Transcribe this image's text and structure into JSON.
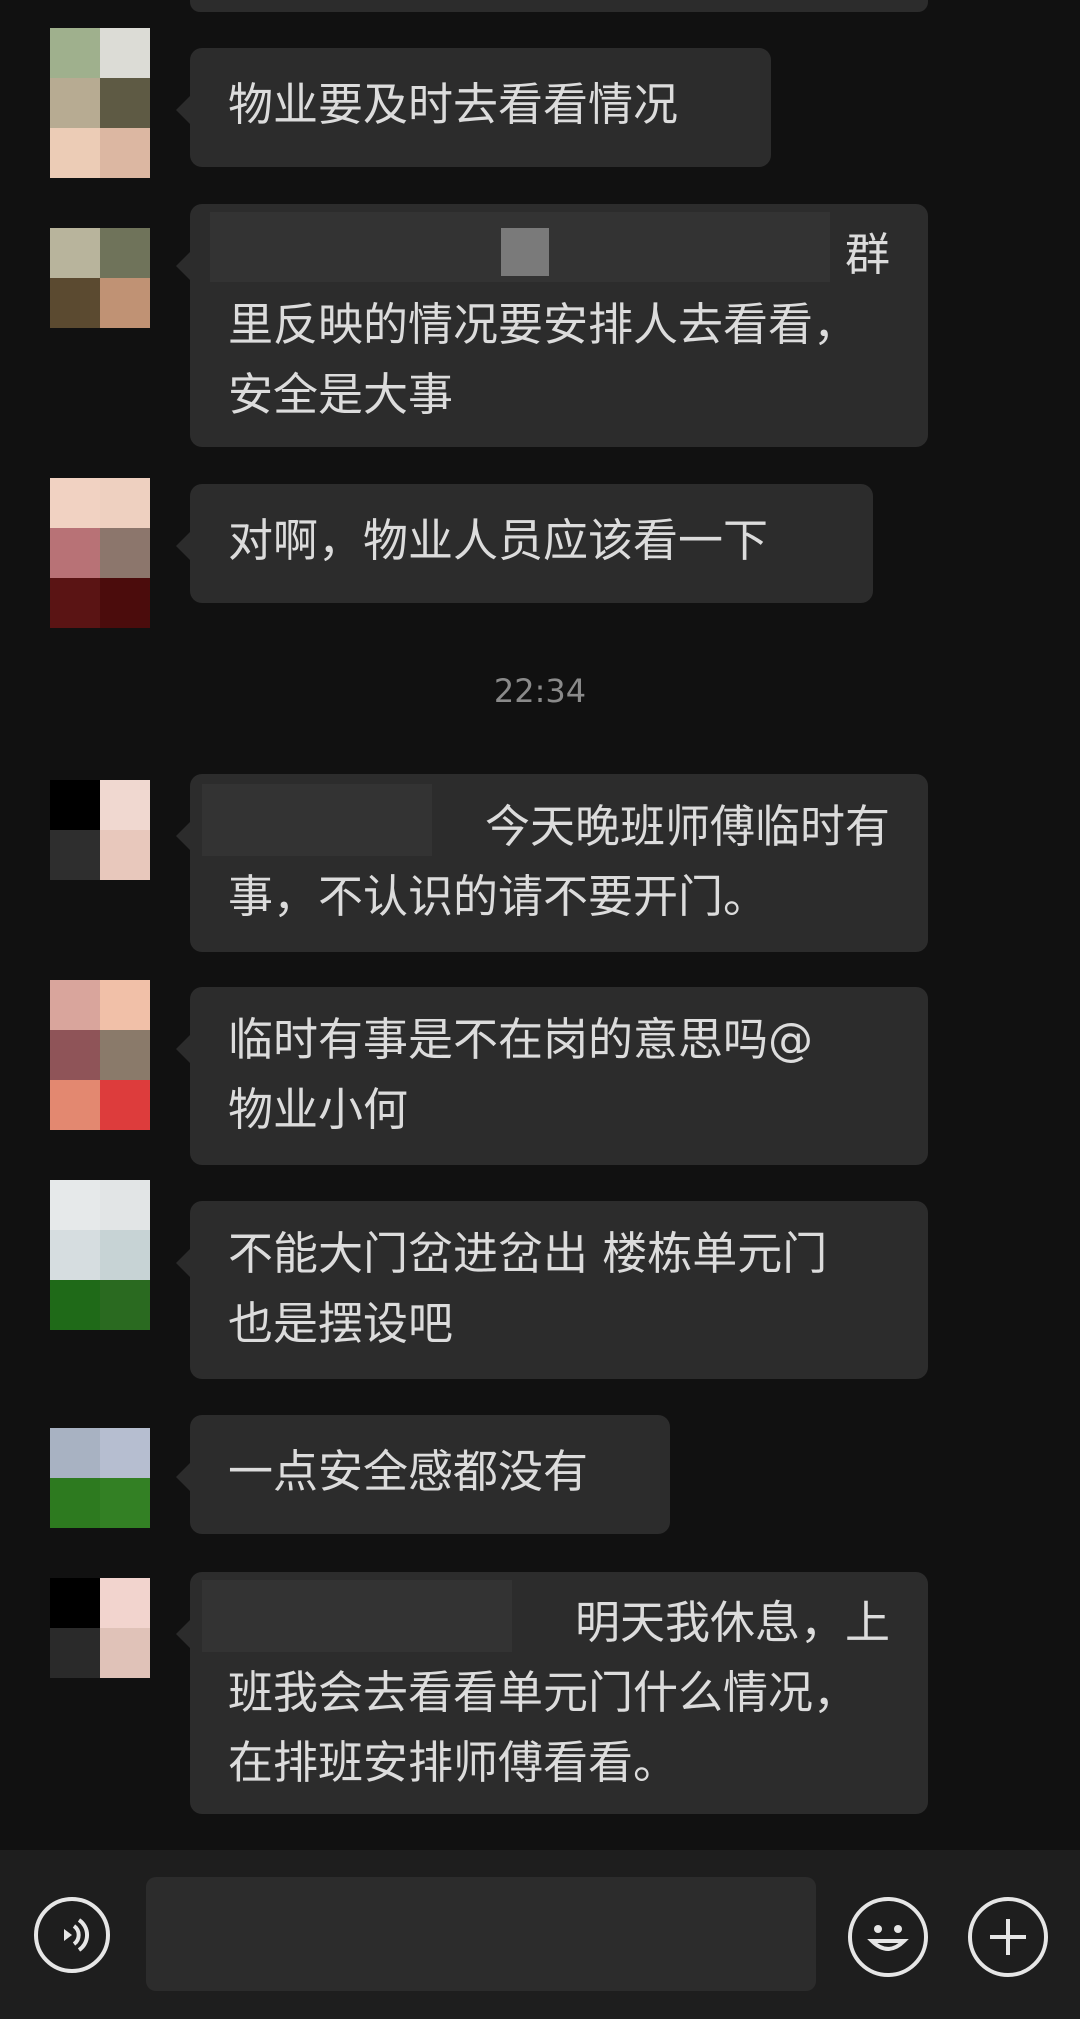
{
  "messages": [
    {
      "lines": [
        "物业要及时去看看情况"
      ]
    },
    {
      "lines": [
        "群",
        "里反映的情况要安排人去看看，",
        "安全是大事"
      ]
    },
    {
      "lines": [
        "对啊，物业人员应该看一下"
      ]
    },
    {
      "lines": [
        "今天晚班师傅临时有",
        "事，不认识的请不要开门。"
      ]
    },
    {
      "lines": [
        "临时有事是不在岗的意思吗@",
        "物业小何"
      ]
    },
    {
      "lines": [
        "不能大门岔进岔出 楼栋单元门",
        "也是摆设吧"
      ]
    },
    {
      "lines": [
        "一点安全感都没有"
      ]
    },
    {
      "lines": [
        "明天我休息，上",
        "班我会去看看单元门什么情况，",
        "在排班安排师傅看看。"
      ]
    }
  ],
  "timestamp": "22:34",
  "input_bar": {
    "voice_icon": "voice-icon",
    "emoji_icon": "emoji-icon",
    "plus_icon": "plus-icon"
  },
  "colors": {
    "background": "#111111",
    "bubble": "#2c2c2c",
    "text": "#dcdcdc",
    "timestamp": "#8a8a8a"
  }
}
